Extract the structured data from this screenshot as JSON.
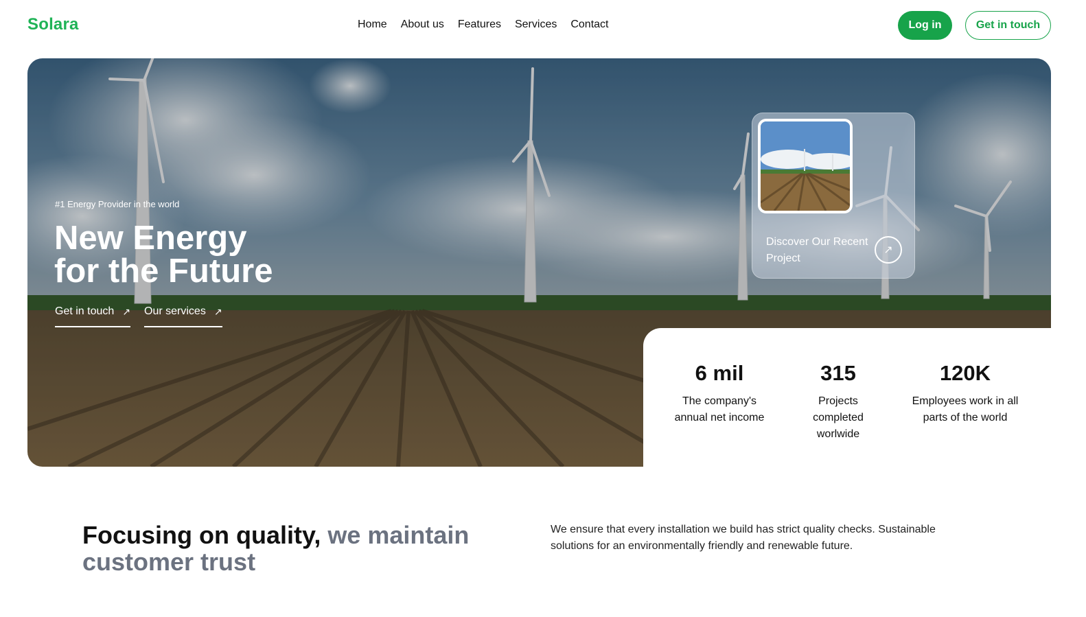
{
  "nav": {
    "logo": "Solara",
    "links": [
      "Home",
      "About us",
      "Features",
      "Services",
      "Contact"
    ],
    "login": "Log in",
    "get_in_touch": "Get in touch"
  },
  "colors": {
    "brand": "#17a34a",
    "logo": "#1fb356",
    "muted_text": "#6b7280"
  },
  "hero": {
    "kicker": "#1 Energy Provider in the world",
    "title_line1": "New Energy",
    "title_line2": "for the Future",
    "link_touch": "Get in touch",
    "link_services": "Our services",
    "link_arrow_icon": "arrow-up-right-icon"
  },
  "project_card": {
    "label": "Discover Our Recent Project",
    "arrow": "↗"
  },
  "stats": [
    {
      "value": "6 mil",
      "label": "The company's annual net income"
    },
    {
      "value": "315",
      "label": "Projects completed worlwide"
    },
    {
      "value": "120K",
      "label": "Employees work in all parts of the world"
    }
  ],
  "quality": {
    "title_main": "Focusing on quality,",
    "title_muted": "we maintain customer trust",
    "text": "We ensure that every installation we build has strict quality checks. Sustainable solutions for an environmentally friendly and renewable future."
  }
}
